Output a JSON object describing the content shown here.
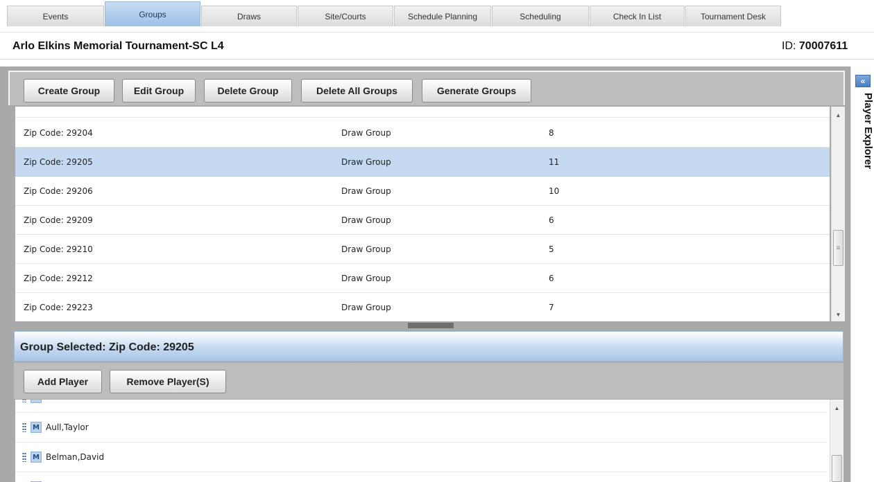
{
  "tabs": [
    {
      "label": "Events",
      "active": false
    },
    {
      "label": "Groups",
      "active": true
    },
    {
      "label": "Draws",
      "active": false
    },
    {
      "label": "Site/Courts",
      "active": false
    },
    {
      "label": "Schedule Planning",
      "active": false
    },
    {
      "label": "Scheduling",
      "active": false
    },
    {
      "label": "Check In List",
      "active": false
    },
    {
      "label": "Tournament Desk",
      "active": false
    }
  ],
  "header": {
    "title": "Arlo Elkins Memorial Tournament-SC L4",
    "id_label": "ID:",
    "id_value": "70007611"
  },
  "toolbar": {
    "create_group": "Create Group",
    "edit_group": "Edit Group",
    "delete_group": "Delete Group",
    "delete_all_groups": "Delete All Groups",
    "generate_groups": "Generate Groups"
  },
  "groups": {
    "rows": [
      {
        "name": "Zip Code: 29204",
        "type": "Draw Group",
        "count": "8",
        "selected": false
      },
      {
        "name": "Zip Code: 29205",
        "type": "Draw Group",
        "count": "11",
        "selected": true
      },
      {
        "name": "Zip Code: 29206",
        "type": "Draw Group",
        "count": "10",
        "selected": false
      },
      {
        "name": "Zip Code: 29209",
        "type": "Draw Group",
        "count": "6",
        "selected": false
      },
      {
        "name": "Zip Code: 29210",
        "type": "Draw Group",
        "count": "5",
        "selected": false
      },
      {
        "name": "Zip Code: 29212",
        "type": "Draw Group",
        "count": "6",
        "selected": false
      },
      {
        "name": "Zip Code: 29223",
        "type": "Draw Group",
        "count": "7",
        "selected": false
      }
    ]
  },
  "selected_group": {
    "label": "Group Selected: Zip Code: 29205",
    "add_player": "Add Player",
    "remove_players": "Remove Player(S)",
    "players": [
      {
        "badge": "M",
        "name": "Aull,Taylor"
      },
      {
        "badge": "M",
        "name": "Belman,David"
      }
    ]
  },
  "sidebar": {
    "collapse_glyph": "«",
    "title": "Player Explorer"
  },
  "colors": {
    "active_tab": "#9cc0e6",
    "selected_row": "#c5daf0",
    "frame_gray": "#a9a9a9"
  }
}
